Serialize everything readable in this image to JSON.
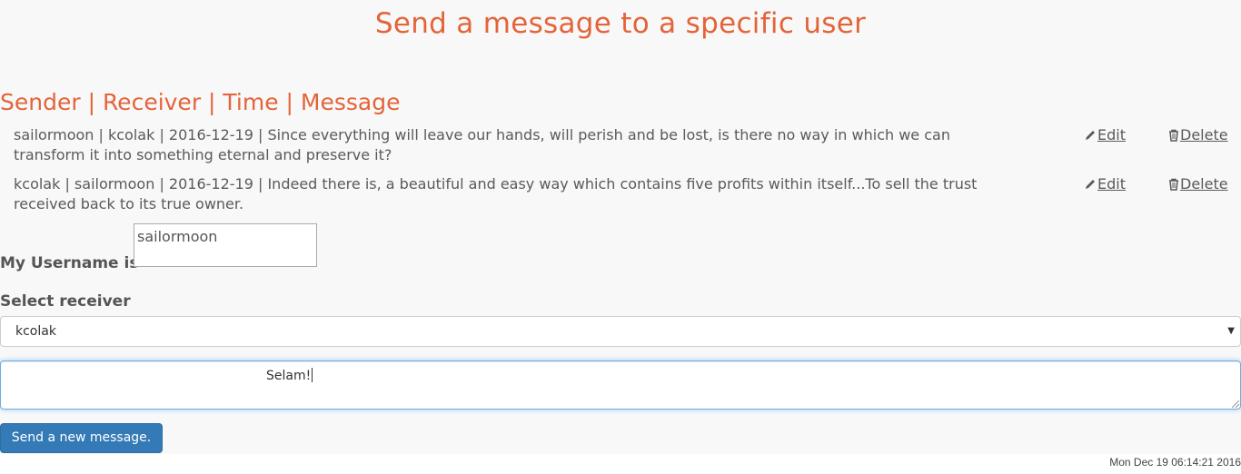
{
  "page": {
    "title": "Send a message to a specific user",
    "heading": "Sender | Receiver | Time | Message"
  },
  "messages": [
    {
      "text": "sailormoon | kcolak | 2016-12-19 | Since everything will leave our hands, will perish and be lost, is there no way in which we can transform it into something eternal and preserve it?",
      "edit_label": "Edit",
      "delete_label": "Delete"
    },
    {
      "text": "kcolak | sailormoon | 2016-12-19 | Indeed there is, a beautiful and easy way which contains five profits within itself...To sell the trust received back to its true owner.",
      "edit_label": "Edit",
      "delete_label": "Delete"
    }
  ],
  "form": {
    "username_label": "My Username is",
    "username_value": "sailormoon",
    "receiver_label": "Select receiver",
    "receiver_selected": "kcolak",
    "message_value": "Selam!",
    "send_label": "Send a new message."
  },
  "footer": {
    "timestamp": "Mon Dec 19 06:14:21 2016"
  },
  "colors": {
    "accent": "#e4643a",
    "button": "#337ab7",
    "focus_border": "#66afe9"
  },
  "icons": {
    "edit": "pencil-icon",
    "delete": "trash-icon",
    "select": "caret-down-icon"
  }
}
